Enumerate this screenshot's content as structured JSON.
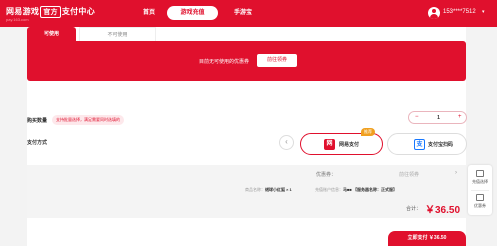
{
  "header": {
    "logo_main": "网易游戏",
    "logo_badge": "官方",
    "logo_tail": "支付中心",
    "logo_sub": "pay.163.com",
    "nav": {
      "home": "首页",
      "recharge": "游戏充值",
      "mall": "手游宝"
    },
    "user_phone": "153****7512",
    "user_caret": "▾"
  },
  "tabs": {
    "available": "可使用",
    "unavailable": "不可使用"
  },
  "coupon": {
    "message": "目前无可使用的优惠券",
    "button": "前往领券"
  },
  "quantity": {
    "label": "购买数量",
    "hint": "支持批量选择，满足需要同时选填的",
    "minus": "−",
    "value": "1",
    "plus": "+"
  },
  "payment": {
    "label": "支付方式",
    "left_arrow": "‹",
    "recommend": "推荐",
    "netease_label": "网易支付",
    "netease_icon": "网",
    "scan_label": "支付宝扫码",
    "scan_icon": "支"
  },
  "summary": {
    "coupon_label": "优惠券：",
    "coupon_value": "前往领券",
    "coupon_arrow": "›",
    "product_label": "商品名称：",
    "product_value": "绒球小红狐 × 1",
    "account_label": "充值账户信息：",
    "account_value": "马■■ 【服务器名称：正式服】",
    "total_label": "合计：",
    "total_value": "￥36.50"
  },
  "submit": {
    "label": "立即支付 ￥36.50"
  },
  "sidepanel": {
    "item1": "充值选择",
    "item2": "优惠券"
  },
  "colors": {
    "brand": "#e0102d",
    "recommend": "#f0a020"
  }
}
